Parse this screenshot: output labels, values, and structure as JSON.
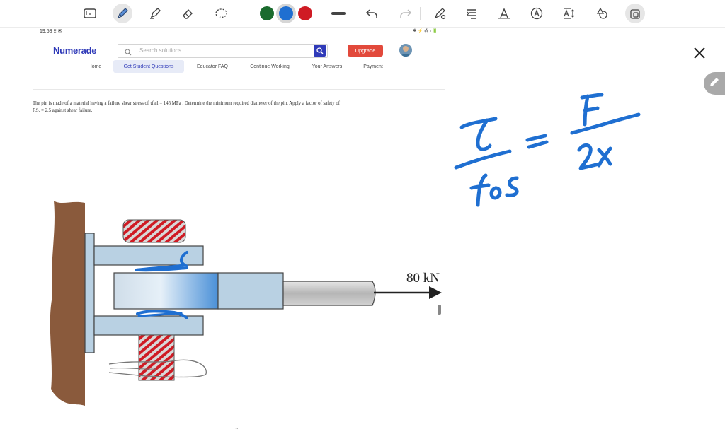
{
  "toolbar": {
    "tools": [
      "keyboard-icon",
      "pen-icon",
      "highlighter-icon",
      "eraser-icon",
      "lasso-icon"
    ],
    "colors": [
      "#1a6b2e",
      "#1f6fd1",
      "#cf1b24"
    ],
    "selected_color": "#1f6fd1",
    "actions": [
      "line-width-icon",
      "undo-icon",
      "redo-icon",
      "pen-settings-icon",
      "text-align-icon",
      "text-style-icon",
      "ai-icon",
      "text-size-icon",
      "shapes-icon",
      "lock-icon"
    ]
  },
  "doc": {
    "status_time": "19:58 ⁝⁝ ✉",
    "status_right": "✱ ⚡ ⁂ ᵢₗ 🔋",
    "logo": "Numerade",
    "search_placeholder": "Search solutions",
    "upgrade_label": "Upgrade",
    "nav": [
      {
        "label": "Home",
        "active": false
      },
      {
        "label": "Get Student Questions",
        "active": true
      },
      {
        "label": "Educator FAQ",
        "active": false
      },
      {
        "label": "Continue Working",
        "active": false
      },
      {
        "label": "Your Answers",
        "active": false
      },
      {
        "label": "Payment",
        "active": false
      }
    ],
    "problem_line1": "The pin is made of a material having a failure shear stress of τfail = 145 MPa . Determine the minimum required diameter of the pin. Apply a factor of safety of",
    "problem_line2": "F.S. = 2.5 against shear failure.",
    "figure_load_label": "80 kN"
  },
  "handwriting": {
    "numerator_left": "τ",
    "denominator_left": "fos",
    "equals": "=",
    "numerator_right": "F",
    "denominator_right": "2x"
  }
}
